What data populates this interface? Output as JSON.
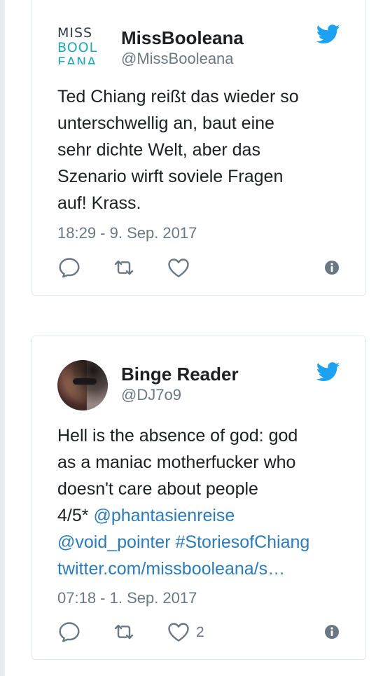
{
  "tweets": [
    {
      "avatar": {
        "logo_lines": [
          "MISS",
          "BOOL",
          "EANA"
        ],
        "colors": {
          "dark": "#2d3a48",
          "teal": "#1fa7b6"
        }
      },
      "author_name": "MissBooleana",
      "author_handle": "@MissBooleana",
      "text_lines": [
        "Ted Chiang reißt das wieder so",
        "unterschwellig an, baut eine",
        "sehr dichte Welt, aber das",
        "Szenario wirft soviele Fragen",
        "auf! Krass."
      ],
      "timestamp": "18:29 - 9. Sep. 2017",
      "like_count": ""
    },
    {
      "author_name": "Binge Reader",
      "author_handle": "@DJ7o9",
      "text_lines": [
        {
          "plain": "Hell is the absence of god: god",
          "link": ""
        },
        {
          "plain": "as a maniac motherfucker who",
          "link": ""
        },
        {
          "plain": "doesn't care about people",
          "link": ""
        },
        {
          "plain": "4/5* ",
          "link": "@phantasienreise"
        },
        {
          "plain": "",
          "link": "@void_pointer #StoriesofChiang"
        },
        {
          "plain": "",
          "link": "twitter.com/missbooleana/s…"
        }
      ],
      "timestamp": "07:18 - 1. Sep. 2017",
      "like_count": "2"
    }
  ],
  "icons": {
    "reply": "reply-icon",
    "retweet": "retweet-icon",
    "like": "heart-icon",
    "info": "info-icon",
    "brand": "twitter-bird-icon"
  },
  "colors": {
    "text": "#1c2022",
    "muted": "#697882",
    "link": "#2b7bb9",
    "bird": "#1da1f2",
    "border": "#e1e8ed"
  }
}
